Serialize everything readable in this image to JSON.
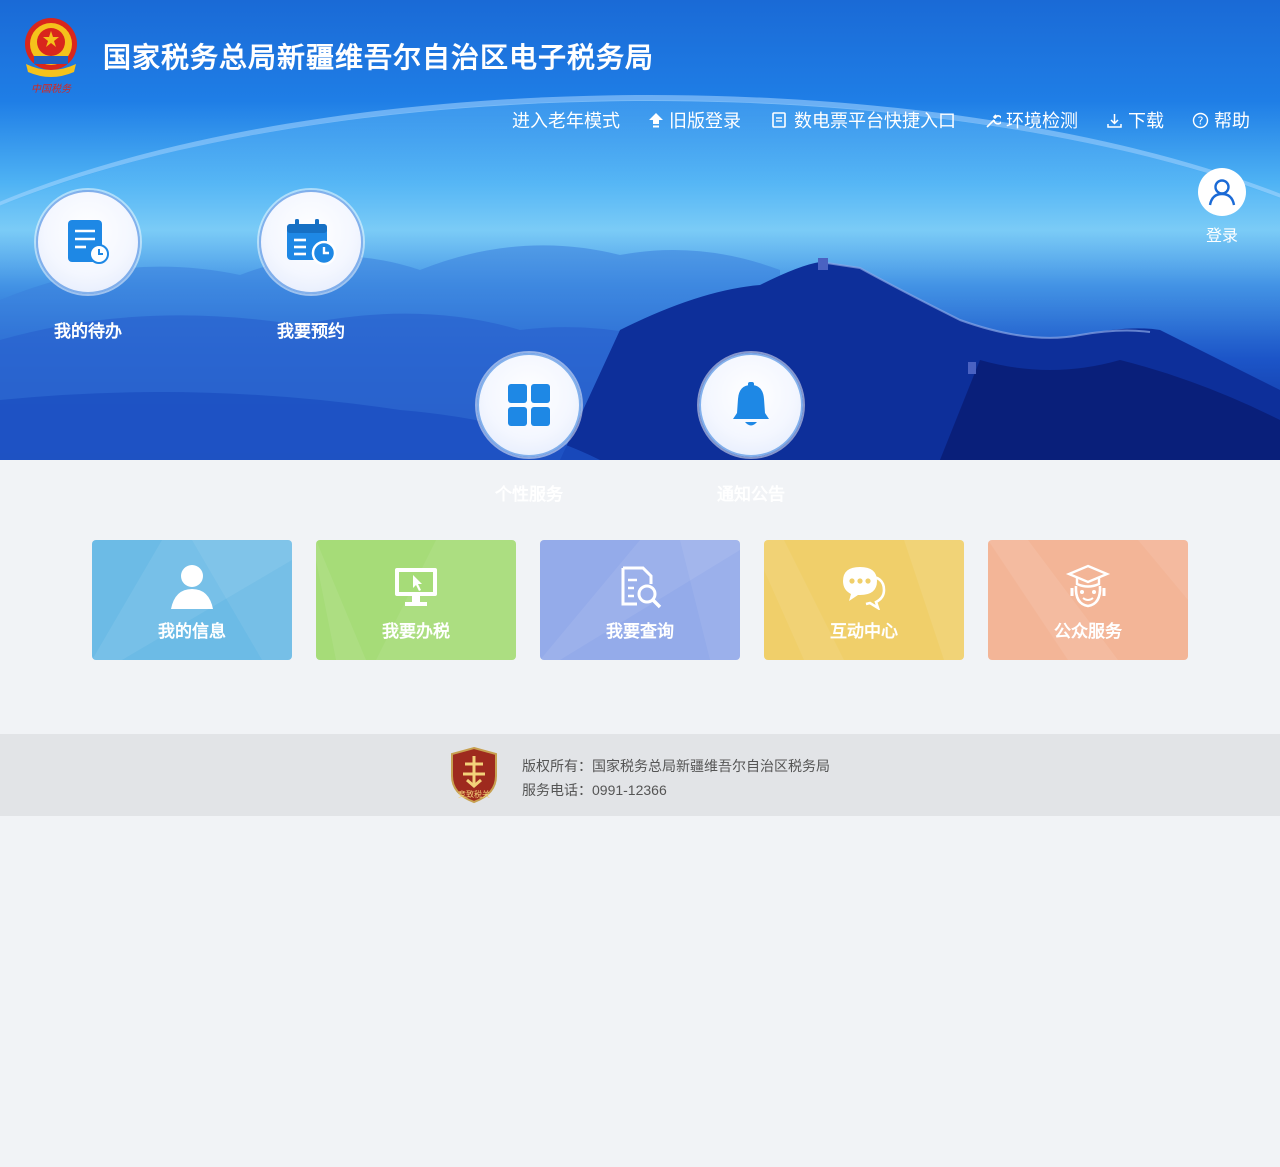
{
  "header": {
    "site_title": "国家税务总局新疆维吾尔自治区电子税务局",
    "emblem_caption": "中国税务"
  },
  "topnav": {
    "items": [
      {
        "label": "进入老年模式",
        "icon": "none"
      },
      {
        "label": "旧版登录",
        "icon": "up-arrow-icon"
      },
      {
        "label": "数电票平台快捷入口",
        "icon": "invoice-icon"
      },
      {
        "label": "环境检测",
        "icon": "wrench-icon"
      },
      {
        "label": "下载",
        "icon": "download-icon"
      },
      {
        "label": "帮助",
        "icon": "help-icon"
      }
    ]
  },
  "login": {
    "label": "登录"
  },
  "quick": {
    "items": [
      {
        "label": "我的待办",
        "icon": "todo-icon"
      },
      {
        "label": "我要预约",
        "icon": "calendar-icon"
      },
      {
        "label": "个性服务",
        "icon": "grid-icon"
      },
      {
        "label": "通知公告",
        "icon": "bell-icon"
      }
    ]
  },
  "tiles": {
    "items": [
      {
        "label": "我的信息",
        "icon": "user-icon",
        "color": "#6cbbe6"
      },
      {
        "label": "我要办税",
        "icon": "monitor-icon",
        "color": "#a6dc78"
      },
      {
        "label": "我要查询",
        "icon": "search-doc-icon",
        "color": "#94abea"
      },
      {
        "label": "互动中心",
        "icon": "chat-icon",
        "color": "#f0cf6a"
      },
      {
        "label": "公众服务",
        "icon": "service-icon",
        "color": "#f3b597"
      }
    ]
  },
  "footer": {
    "badge_text": "竞致税关",
    "copyright": "版权所有：国家税务总局新疆维吾尔自治区税务局",
    "phone": "服务电话：0991-12366"
  }
}
